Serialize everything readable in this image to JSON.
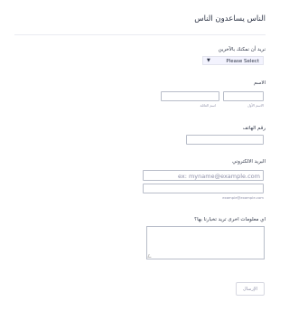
{
  "form": {
    "title": "الناس يساعدون الناس",
    "help_question": {
      "label": "نريد أن نمكنك بالآخرين",
      "selected": "Please Select"
    },
    "name": {
      "label": "الاسم",
      "first_sublabel": "الاسم الأول",
      "last_sublabel": "اسم العائلة",
      "first_value": "",
      "last_value": ""
    },
    "phone": {
      "label": "رقم الهاتف",
      "value": ""
    },
    "email": {
      "label": "البريد الالكتروني",
      "placeholder": "ex: myname@example.com",
      "confirm_value": "",
      "sublabel": "example@example.com"
    },
    "more_info": {
      "label": "اي معلومات اخرى تريد تخبارنا بها؟",
      "value": ""
    },
    "submit_label": "الإرسال"
  }
}
